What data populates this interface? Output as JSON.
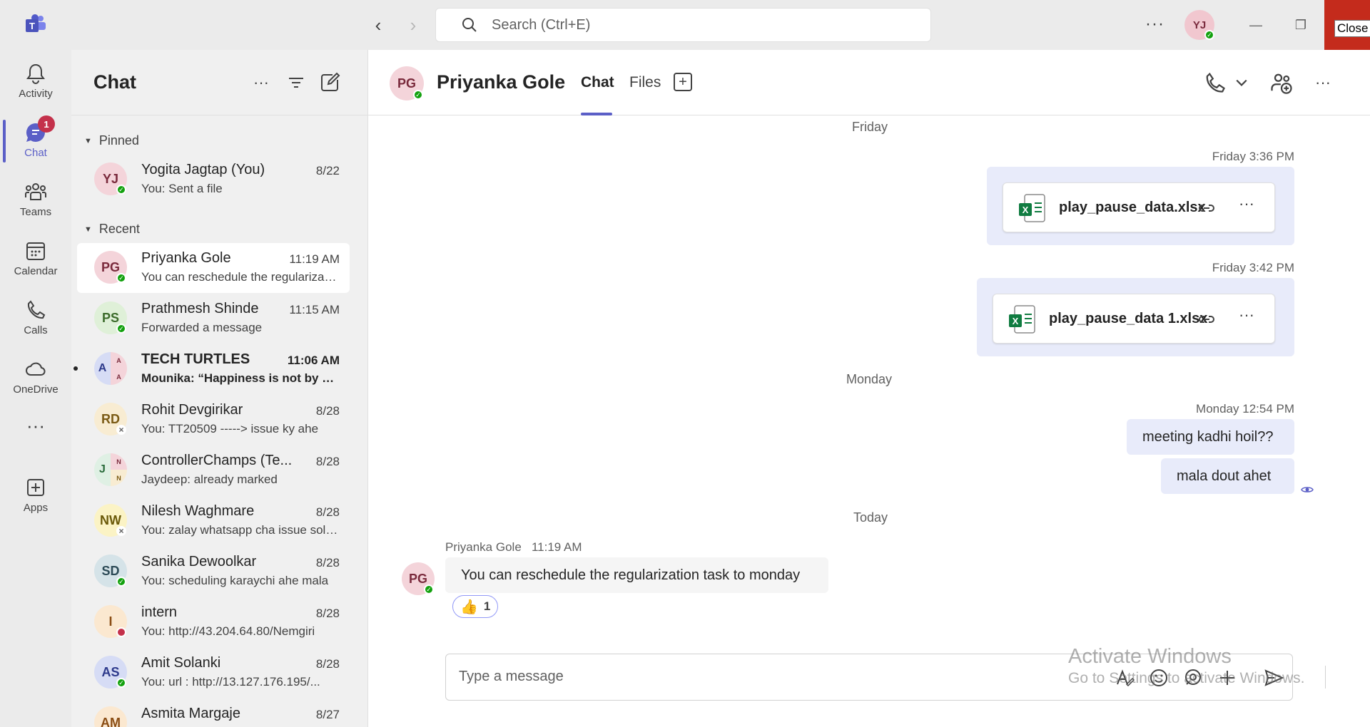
{
  "titlebar": {
    "search_placeholder": "Search (Ctrl+E)",
    "user_initials": "YJ",
    "close_tooltip": "Close"
  },
  "rail": {
    "items": [
      {
        "label": "Activity",
        "icon": "bell-icon"
      },
      {
        "label": "Chat",
        "icon": "chat-icon",
        "badge": "1"
      },
      {
        "label": "Teams",
        "icon": "teams-icon"
      },
      {
        "label": "Calendar",
        "icon": "calendar-icon"
      },
      {
        "label": "Calls",
        "icon": "phone-icon"
      },
      {
        "label": "OneDrive",
        "icon": "cloud-icon"
      },
      {
        "label": "",
        "icon": "more-icon"
      },
      {
        "label": "Apps",
        "icon": "apps-icon"
      }
    ]
  },
  "chat_list": {
    "title": "Chat",
    "pinned_label": "Pinned",
    "recent_label": "Recent",
    "pinned": [
      {
        "initials": "YJ",
        "name": "Yogita Jagtap (You)",
        "time": "8/22",
        "preview": "You: Sent a file"
      }
    ],
    "recent": [
      {
        "initials": "PG",
        "name": "Priyanka Gole",
        "time": "11:19 AM",
        "preview": "You can reschedule the regularization task to monday"
      },
      {
        "initials": "PS",
        "name": "Prathmesh Shinde",
        "time": "11:15 AM",
        "preview": "Forwarded a message"
      },
      {
        "initials": "A",
        "group_initials": [
          "A",
          "A"
        ],
        "name": "TECH TURTLES",
        "time": "11:06 AM",
        "preview": "Mounika: “Happiness is not by chance”"
      },
      {
        "initials": "RD",
        "name": "Rohit Devgirikar",
        "time": "8/28",
        "preview": "You: TT20509   -----> issue ky ahe"
      },
      {
        "initials": "J",
        "group_initials": [
          "N",
          "N"
        ],
        "name": "ControllerChamps (Te...",
        "time": "8/28",
        "preview": "Jaydeep: already marked"
      },
      {
        "initials": "NW",
        "name": "Nilesh Waghmare",
        "time": "8/28",
        "preview": "You: zalay whatsapp cha issue solve"
      },
      {
        "initials": "SD",
        "name": "Sanika Dewoolkar",
        "time": "8/28",
        "preview": "You: scheduling karaychi ahe mala"
      },
      {
        "initials": "I",
        "name": "intern",
        "time": "8/28",
        "preview": "You: http://43.204.64.80/Nemgiri"
      },
      {
        "initials": "AS",
        "name": "Amit Solanki",
        "time": "8/28",
        "preview": "You: url : http://13.127.176.195/..."
      },
      {
        "initials": "AM",
        "name": "Asmita Margaje",
        "time": "8/27",
        "preview": ""
      }
    ]
  },
  "conversation": {
    "contact_initials": "PG",
    "contact_name": "Priyanka Gole",
    "tabs": [
      "Chat",
      "Files"
    ],
    "day_friday": "Friday",
    "msg1_time": "Friday 3:36 PM",
    "file1": "play_pause_data.xlsx",
    "msg2_time": "Friday 3:42 PM",
    "file2": "play_pause_data 1.xlsx",
    "day_monday": "Monday",
    "msg3_time": "Monday 12:54 PM",
    "msg3_text": "meeting kadhi hoil??",
    "msg4_text": "mala dout ahet",
    "day_today": "Today",
    "incoming_sender": "Priyanka Gole",
    "incoming_time": "11:19 AM",
    "incoming_text": "You can reschedule the regularization task to monday",
    "reaction_emoji": "👍",
    "reaction_count": "1"
  },
  "compose": {
    "placeholder": "Type a message"
  },
  "watermark": {
    "line1": "Activate Windows",
    "line2": "Go to Settings to activate Windows."
  },
  "colors": {
    "accent": "#5b5fc7",
    "available": "#13a10e",
    "busy": "#c4314b",
    "close_red": "#c42b1c",
    "bubble_own": "#e8ebfa"
  }
}
